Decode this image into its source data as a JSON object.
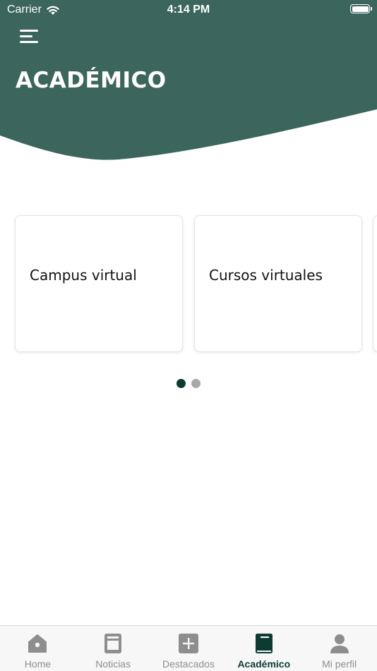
{
  "status_bar": {
    "carrier": "Carrier",
    "time": "4:14 PM"
  },
  "header": {
    "title": "ACADÉMICO",
    "background_color": "#3c665d"
  },
  "carousel": {
    "cards": [
      {
        "label": "Campus virtual"
      },
      {
        "label": "Cursos virtuales"
      }
    ],
    "page_count": 2,
    "active_page": 1
  },
  "tab_bar": {
    "active_color": "#0d3b33",
    "inactive_color": "#8e8e8e",
    "tabs": [
      {
        "label": "Home",
        "icon": "home-icon",
        "active": false
      },
      {
        "label": "Noticias",
        "icon": "news-icon",
        "active": false
      },
      {
        "label": "Destacados",
        "icon": "plus-square-icon",
        "active": false
      },
      {
        "label": "Académico",
        "icon": "book-icon",
        "active": true
      },
      {
        "label": "Mi perfil",
        "icon": "person-icon",
        "active": false
      }
    ]
  }
}
